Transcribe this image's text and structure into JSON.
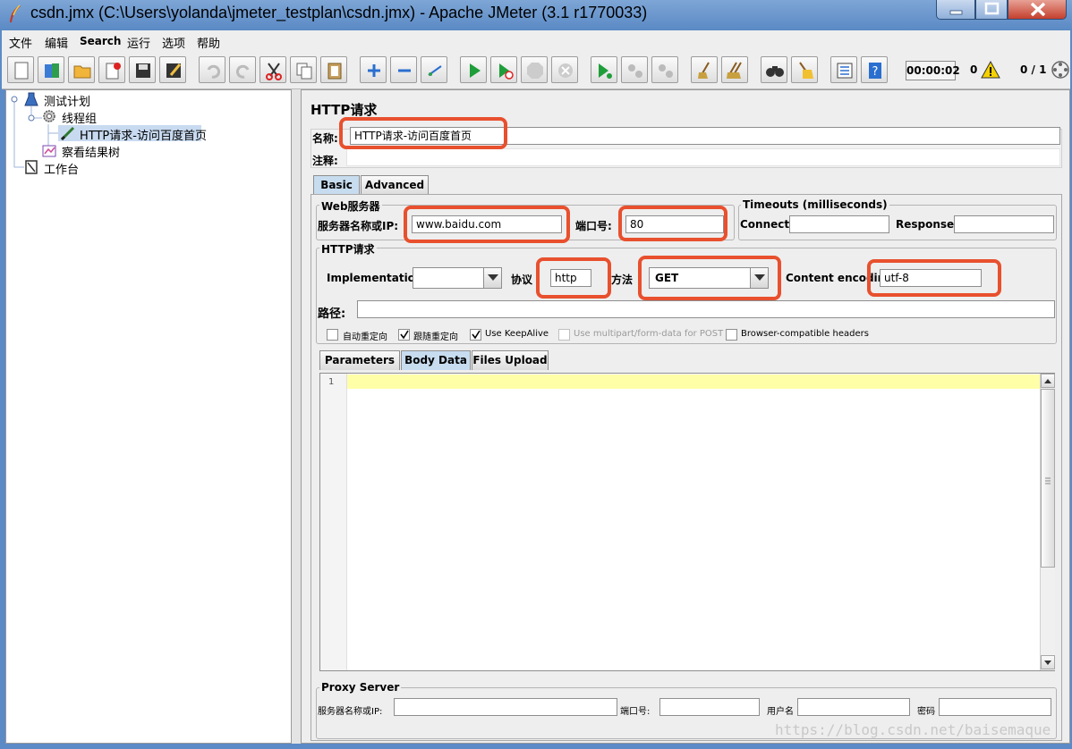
{
  "window": {
    "title": "csdn.jmx (C:\\Users\\yolanda\\jmeter_testplan\\csdn.jmx) - Apache JMeter (3.1 r1770033)"
  },
  "menu": [
    "文件",
    "编辑",
    "Search",
    "运行",
    "选项",
    "帮助"
  ],
  "toolbar": {
    "timer": "00:00:02",
    "error_count": "0",
    "thread_count": "0 / 1"
  },
  "tree": {
    "items": [
      {
        "label": "测试计划"
      },
      {
        "label": "线程组"
      },
      {
        "label": "HTTP请求-访问百度首页"
      },
      {
        "label": "察看结果树"
      },
      {
        "label": "工作台"
      }
    ]
  },
  "panel": {
    "title": "HTTP请求",
    "name_label": "名称:",
    "name_value": "HTTP请求-访问百度首页",
    "comment_label": "注释:",
    "comment_value": "",
    "tabs": [
      "Basic",
      "Advanced"
    ],
    "web_server": {
      "group_title": "Web服务器",
      "server_label": "服务器名称或IP:",
      "server_value": "www.baidu.com",
      "port_label": "端口号:",
      "port_value": "80"
    },
    "timeouts": {
      "group_title": "Timeouts (milliseconds)",
      "connect_label": "Connect:",
      "connect_value": "",
      "response_label": "Response:",
      "response_value": ""
    },
    "http_request": {
      "group_title": "HTTP请求",
      "impl_label": "Implementation:",
      "impl_value": "",
      "protocol_label": "协议",
      "protocol_value": "http",
      "method_label": "方法",
      "method_value": "GET",
      "encoding_label": "Content encoding:",
      "encoding_value": "utf-8",
      "path_label": "路径:",
      "path_value": ""
    },
    "checkboxes": [
      {
        "label": "自动重定向",
        "checked": false,
        "disabled": false
      },
      {
        "label": "跟随重定向",
        "checked": true,
        "disabled": false
      },
      {
        "label": "Use KeepAlive",
        "checked": true,
        "disabled": false
      },
      {
        "label": "Use multipart/form-data for POST",
        "checked": false,
        "disabled": true
      },
      {
        "label": "Browser-compatible headers",
        "checked": false,
        "disabled": false
      }
    ],
    "sub_tabs": [
      "Parameters",
      "Body Data",
      "Files Upload"
    ],
    "editor": {
      "line_number": "1"
    },
    "proxy": {
      "group_title": "Proxy Server",
      "server_label": "服务器名称或IP:",
      "port_label": "端口号:",
      "user_label": "用户名",
      "password_label": "密码"
    }
  },
  "watermark": "https://blog.csdn.net/baisemaque",
  "colors": {
    "highlight": "#e8502e",
    "title_bar": "#5a89c4",
    "active_tab": "#c7dcef",
    "editor_line": "#ffffa8"
  }
}
